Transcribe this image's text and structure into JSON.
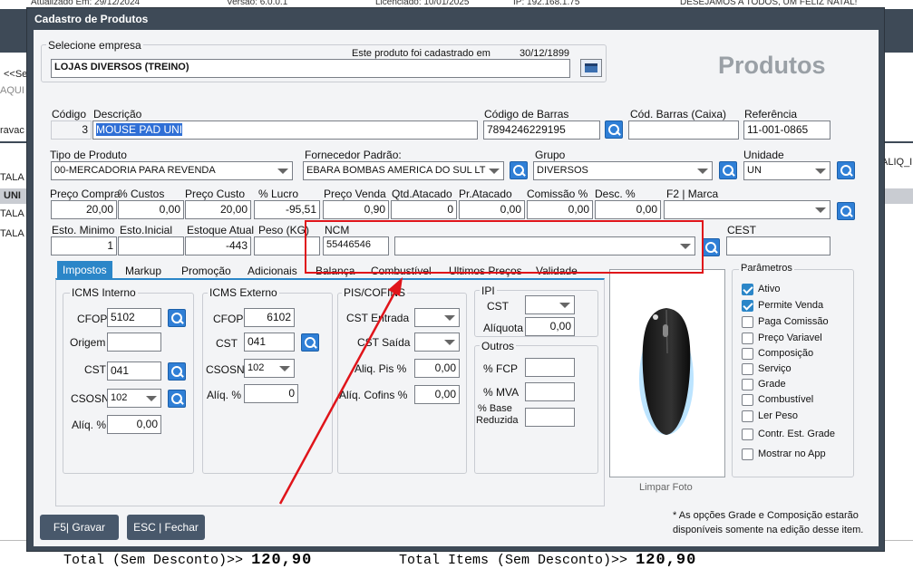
{
  "background": {
    "top_left": "Atualizado Em: 29/12/2024",
    "top_version": "Versão: 6.0.0.1",
    "top_license": "Licenciado: 10/01/2025",
    "top_ip": "IP: 192.168.1.75",
    "top_msg": "DESEJAMOS A TODOS, UM FELIZ NATAL!",
    "frag_se": "<<Se",
    "frag_aqui": "AQUI S",
    "frag_grav": "ravac",
    "frag_tala1": "TALA",
    "frag_uni": "UNI",
    "frag_tala2": "TALA",
    "frag_tala3": "TALA",
    "frag_aliq": "ALIQ_I",
    "total_label": "Total (Sem Desconto)>>",
    "total_value": "120,90",
    "items_label": "Total Items (Sem Desconto)>>",
    "items_value": "120,90"
  },
  "dialog": {
    "title": "Cadastro de Produtos",
    "heading": "Produtos",
    "empresa_label": "Selecione empresa",
    "cadastrado_label": "Este produto foi cadastrado em",
    "cadastrado_date": "30/12/1899",
    "empresa_value": "LOJAS DIVERSOS (TREINO)",
    "codigo_label": "Código",
    "codigo_value": "3",
    "descricao_label": "Descrição",
    "descricao_value": "MOUSE PAD  UNI",
    "barras_label": "Código de Barras",
    "barras_value": "7894246229195",
    "barras_caixa_label": "Cód. Barras (Caixa)",
    "barras_caixa_value": "",
    "referencia_label": "Referência",
    "referencia_value": "11-001-0865",
    "tipo_label": "Tipo de Produto",
    "tipo_value": "00-MERCADORIA PARA REVENDA",
    "fornecedor_label": "Fornecedor Padrão:",
    "fornecedor_value": "EBARA BOMBAS AMERICA DO SUL LT",
    "grupo_label": "Grupo",
    "grupo_value": "DIVERSOS",
    "unidade_label": "Unidade",
    "unidade_value": "UN",
    "preco_compra_label": "Preço Compra",
    "preco_compra_value": "20,00",
    "custos_label": "% Custos",
    "custos_value": "0,00",
    "preco_custo_label": "Preço Custo",
    "preco_custo_value": "20,00",
    "lucro_label": "% Lucro",
    "lucro_value": "-95,51",
    "preco_venda_label": "Preço Venda",
    "preco_venda_value": "0,90",
    "qtd_atacado_label": "Qtd.Atacado",
    "qtd_atacado_value": "0",
    "pr_atacado_label": "Pr.Atacado",
    "pr_atacado_value": "0,00",
    "comissao_label": "Comissão %",
    "comissao_value": "0,00",
    "desc_label": "Desc. %",
    "desc_value": "0,00",
    "marca_label": "F2 | Marca",
    "marca_value": "",
    "esto_min_label": "Esto. Minimo",
    "esto_min_value": "1",
    "esto_ini_label": "Esto.Inicial",
    "esto_ini_value": "",
    "esto_atual_label": "Estoque Atual",
    "esto_atual_value": "-443",
    "peso_label": "Peso (KG)",
    "peso_value": "",
    "ncm_label": "NCM",
    "ncm_value": "55446546",
    "ncm_desc": "",
    "cest_label": "CEST",
    "cest_value": ""
  },
  "tabs": [
    "Impostos",
    "Markup",
    "Promoção",
    "Adicionais",
    "Balança",
    "Combustível",
    "Ultimos Preços",
    "Validade"
  ],
  "icms_interno": {
    "title": "ICMS Interno",
    "cfop_label": "CFOP",
    "cfop_value": "5102",
    "origem_label": "Origem",
    "origem_value": "",
    "cst_label": "CST",
    "cst_value": "041",
    "csosn_label": "CSOSN",
    "csosn_value": "102",
    "aliq_label": "Alíq. %",
    "aliq_value": "0,00"
  },
  "icms_externo": {
    "title": "ICMS Externo",
    "cfop_label": "CFOP",
    "cfop_value": "6102",
    "cst_label": "CST",
    "cst_value": "041",
    "csosn_label": "CSOSN",
    "csosn_value": "102",
    "aliq_label": "Alíq. %",
    "aliq_value": "0"
  },
  "pis_cofins": {
    "title": "PIS/COFINS",
    "cst_entrada_label": "CST Entrada",
    "cst_saida_label": "CST Saída",
    "aliq_pis_label": "Aliq. Pis %",
    "aliq_pis_value": "0,00",
    "aliq_cofins_label": "Alíq. Cofins %",
    "aliq_cofins_value": "0,00"
  },
  "ipi": {
    "title": "IPI",
    "cst_label": "CST",
    "aliquota_label": "Alíquota",
    "aliquota_value": "0,00"
  },
  "outros": {
    "title": "Outros",
    "fcp_label": "% FCP",
    "mva_label": "% MVA",
    "base_label1": "% Base",
    "base_label2": "Reduzida"
  },
  "photo": {
    "clear_label": "Limpar Foto"
  },
  "parametros": {
    "title": "Parâmetros",
    "items": [
      {
        "label": "Ativo",
        "checked": true
      },
      {
        "label": "Permite Venda",
        "checked": true
      },
      {
        "label": "Paga Comissão",
        "checked": false
      },
      {
        "label": "Preço Variavel",
        "checked": false
      },
      {
        "label": "Composição",
        "checked": false
      },
      {
        "label": "Serviço",
        "checked": false
      },
      {
        "label": "Grade",
        "checked": false
      },
      {
        "label": "Combustível",
        "checked": false
      },
      {
        "label": "Ler Peso",
        "checked": false
      },
      {
        "label": "Contr. Est. Grade",
        "checked": false
      },
      {
        "label": "Mostrar no App",
        "checked": false
      }
    ]
  },
  "footer": {
    "gravar": "F5| Gravar",
    "fechar": "ESC | Fechar",
    "note1": "* As opções Grade e Composição estarão",
    "note2": "disponíveis somente na edição desse item."
  },
  "colors": {
    "dialog_frame": "#3e4a57",
    "tab_active": "#2b86c8",
    "annotation": "#e0141a",
    "selection": "#2f6fd6"
  }
}
